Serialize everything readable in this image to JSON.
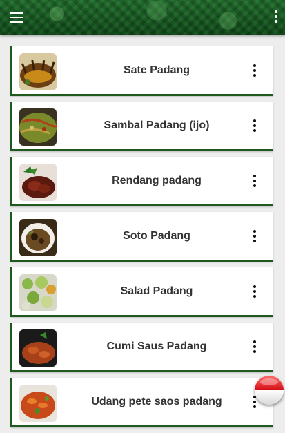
{
  "header": {
    "menu_icon": "hamburger-menu-icon",
    "overflow_icon": "vertical-dots-icon",
    "brand_color": "#1a5e22"
  },
  "recipes": [
    {
      "title": "Sate Padang",
      "thumb_color": "#8a5a1a"
    },
    {
      "title": "Sambal Padang (ijo)",
      "thumb_color": "#6b7a22"
    },
    {
      "title": "Rendang padang",
      "thumb_color": "#7a2a1a"
    },
    {
      "title": "Soto Padang",
      "thumb_color": "#4a3a22"
    },
    {
      "title": "Salad Padang",
      "thumb_color": "#6a8a3a"
    },
    {
      "title": "Cumi Saus Padang",
      "thumb_color": "#9a3a1a"
    },
    {
      "title": "Udang pete saos padang",
      "thumb_color": "#b0401a"
    }
  ],
  "language_button": {
    "icon": "indonesia-flag-icon",
    "colors": [
      "#d40f14",
      "#ffffff"
    ]
  }
}
